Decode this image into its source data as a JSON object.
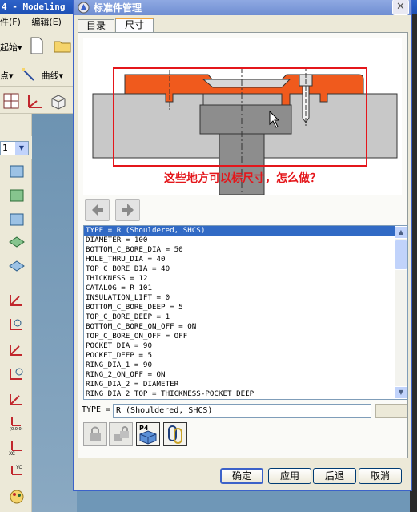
{
  "background_app": {
    "title": "4 - Modeling",
    "menu": [
      "件(F)",
      "编辑(E)"
    ],
    "start_label": "起始",
    "point_label": "点",
    "curve_label": "曲线",
    "layer_combo_value": "1"
  },
  "dialog": {
    "title": "标准件管理",
    "tabs": [
      "目录",
      "尺寸"
    ],
    "active_tab": "尺寸",
    "annotation": "这些地方可以标尺寸，怎么做？",
    "parameters": [
      "TYPE = R (Shouldered, SHCS)",
      "DIAMETER = 100",
      "BOTTOM_C_BORE_DIA = 50",
      "HOLE_THRU_DIA = 40",
      "TOP_C_BORE_DIA = 40",
      "THICKNESS = 12",
      "CATALOG = R 101",
      "INSULATION_LIFT = 0",
      "BOTTOM_C_BORE_DEEP = 5",
      "TOP_C_BORE_DEEP = 1",
      "BOTTOM_C_BORE_ON_OFF = ON",
      "TOP_C_BORE_ON_OFF = OFF",
      "POCKET_DIA = 90",
      "POCKET_DEEP = 5",
      "RING_DIA_1 = 90",
      "RING_2_ON_OFF = ON",
      "RING_DIA_2 = DIAMETER",
      "RING_DIA_2_TOP = THICKNESS-POCKET_DEEP"
    ],
    "selected_index": 0,
    "field_label": "TYPE =",
    "field_value": "R (Shouldered, SHCS)",
    "tool_p4_label": "P4",
    "buttons": {
      "ok": "确定",
      "apply": "应用",
      "back": "后退",
      "cancel": "取消"
    }
  },
  "colors": {
    "dialog_bg": "#ece9d8",
    "title_bar": "#7d99d8",
    "selection": "#316ac5",
    "ring_orange": "#f05a1d",
    "annotation_red": "#e4161b",
    "part_gray": "#c8c8c8"
  },
  "icons": [
    "close-icon",
    "arrow-left-icon",
    "arrow-right-icon",
    "lock-icon",
    "lock-icon",
    "part-p4-icon",
    "link-icon"
  ]
}
